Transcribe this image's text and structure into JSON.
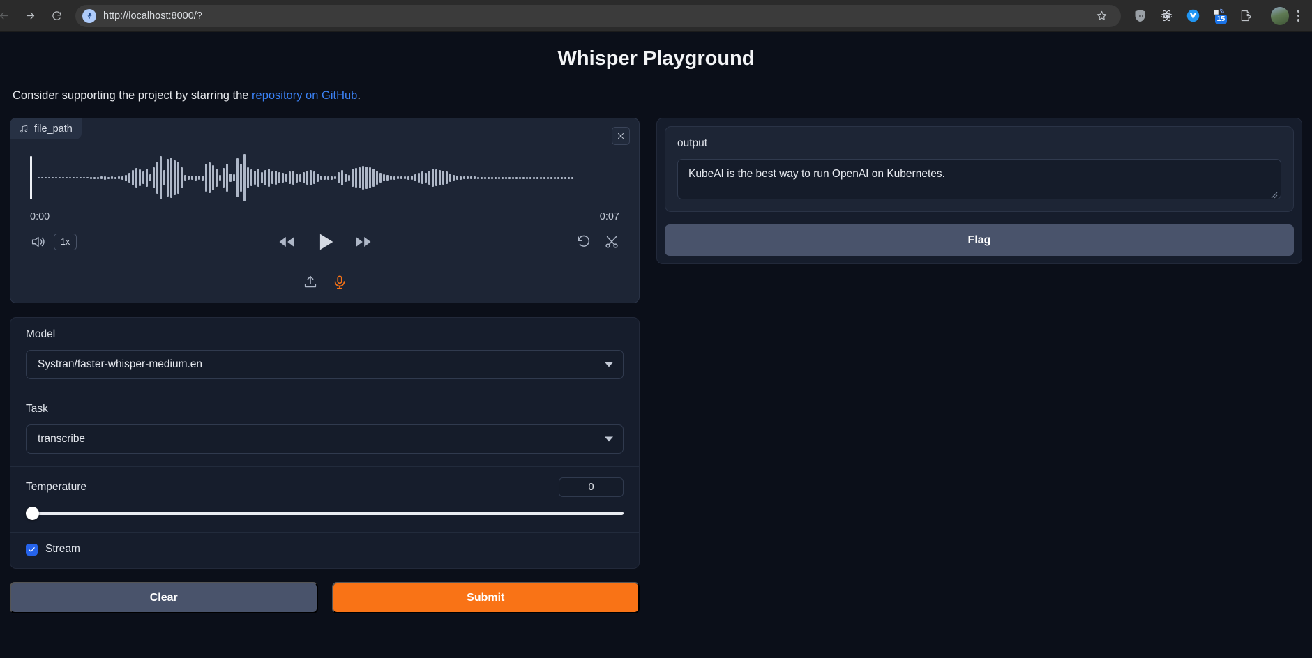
{
  "browser": {
    "url": "http://localhost:8000/?",
    "back_icon": "back-arrow-icon",
    "forward_icon": "forward-arrow-icon",
    "reload_icon": "reload-icon",
    "favicon": "microphone-favicon",
    "star_icon": "bookmark-star-icon",
    "extensions": [
      {
        "name": "ublock-origin-icon",
        "badge": ""
      },
      {
        "name": "react-devtools-icon",
        "badge": ""
      },
      {
        "name": "vue-devtools-icon",
        "badge": ""
      },
      {
        "name": "tab-manager-icon",
        "badge": "15"
      },
      {
        "name": "extensions-puzzle-icon",
        "badge": ""
      }
    ],
    "avatar": "profile-avatar",
    "menu_icon": "chrome-menu-icon"
  },
  "header": {
    "title": "Whisper Playground",
    "subtitle_before": "Consider supporting the project by starring the ",
    "subtitle_link": "repository on GitHub",
    "subtitle_after": "."
  },
  "audio": {
    "tag_label": "file_path",
    "tag_icon": "music-note-icon",
    "close_icon": "close-icon",
    "time_start": "0:00",
    "time_end": "0:07",
    "volume_icon": "volume-icon",
    "speed_label": "1x",
    "rewind_icon": "rewind-icon",
    "play_icon": "play-icon",
    "forward_icon": "fast-forward-icon",
    "undo_icon": "undo-icon",
    "trim_icon": "scissors-trim-icon",
    "upload_icon": "upload-icon",
    "record_icon": "microphone-record-icon",
    "waveform_heights": [
      62,
      2,
      2,
      2,
      2,
      2,
      2,
      2,
      2,
      2,
      2,
      2,
      2,
      2,
      2,
      2,
      3,
      3,
      3,
      4,
      5,
      3,
      4,
      3,
      4,
      5,
      9,
      14,
      22,
      28,
      24,
      18,
      26,
      10,
      30,
      46,
      62,
      22,
      54,
      58,
      50,
      46,
      30,
      8,
      6,
      6,
      7,
      6,
      7,
      40,
      44,
      36,
      26,
      8,
      28,
      40,
      12,
      10,
      56,
      40,
      68,
      30,
      24,
      20,
      26,
      16,
      22,
      26,
      18,
      20,
      16,
      14,
      12,
      18,
      20,
      13,
      11,
      16,
      20,
      22,
      18,
      12,
      6,
      6,
      5,
      5,
      4,
      16,
      22,
      12,
      8,
      26,
      28,
      30,
      34,
      32,
      30,
      26,
      20,
      14,
      10,
      8,
      6,
      5,
      4,
      4,
      4,
      5,
      6,
      10,
      14,
      18,
      14,
      20,
      26,
      24,
      22,
      20,
      18,
      12,
      8,
      6,
      5,
      4,
      4,
      4,
      4,
      3,
      3,
      3,
      3,
      3,
      3,
      3,
      3,
      3,
      3,
      3,
      3,
      3,
      3,
      3,
      3,
      3,
      3,
      3,
      3,
      3,
      3,
      3,
      3,
      3,
      3,
      3,
      3
    ]
  },
  "settings": {
    "model_label": "Model",
    "model_value": "Systran/faster-whisper-medium.en",
    "task_label": "Task",
    "task_value": "transcribe",
    "temperature_label": "Temperature",
    "temperature_value": "0",
    "temperature_slider_percent": 0,
    "stream_label": "Stream",
    "stream_checked": true
  },
  "actions": {
    "clear_label": "Clear",
    "submit_label": "Submit",
    "submit_color": "#f97316"
  },
  "output": {
    "label": "output",
    "text": "KubeAI is the best way to run OpenAI on Kubernetes.",
    "flag_label": "Flag"
  }
}
